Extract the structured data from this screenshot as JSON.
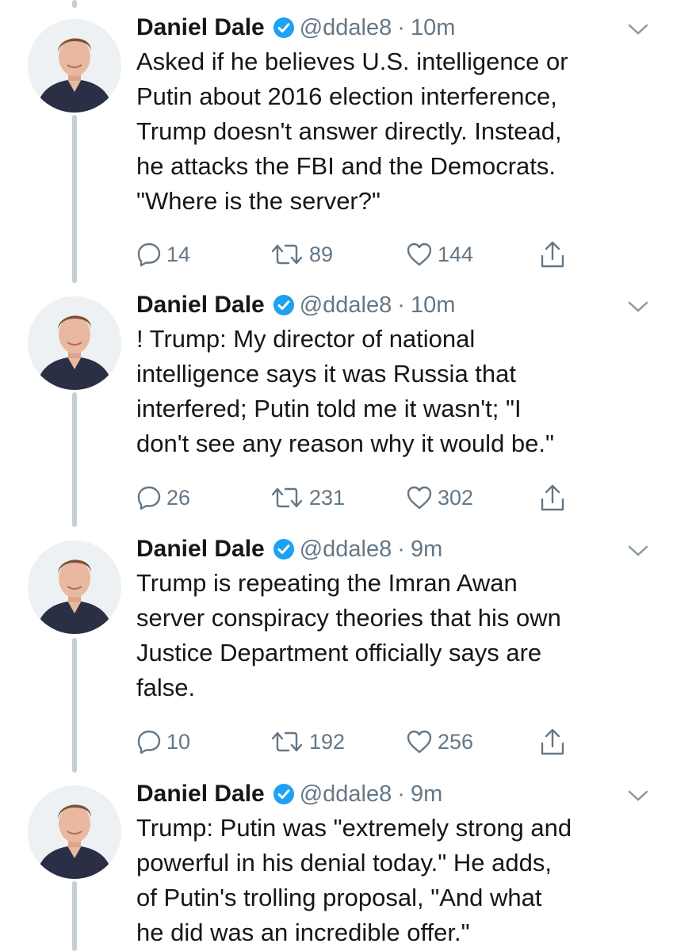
{
  "tweets": [
    {
      "name": "Daniel Dale",
      "handle": "@ddale8",
      "separator": "·",
      "time": "10m",
      "text": "Asked if he believes U.S. intelligence or\nPutin about 2016 election interference,\nTrump doesn't answer directly. Instead,\nhe attacks the FBI and the Democrats.\n\"Where is the server?\"",
      "replies": "14",
      "retweets": "89",
      "likes": "144"
    },
    {
      "name": "Daniel Dale",
      "handle": "@ddale8",
      "separator": "·",
      "time": "10m",
      "text": "! Trump: My director of national\nintelligence says it was Russia that\ninterfered; Putin told me it wasn't; \"I\ndon't see any reason why it would be.\"",
      "replies": "26",
      "retweets": "231",
      "likes": "302"
    },
    {
      "name": "Daniel Dale",
      "handle": "@ddale8",
      "separator": "·",
      "time": "9m",
      "text": "Trump is repeating the Imran Awan\nserver conspiracy theories that his own\nJustice Department officially says are\nfalse.",
      "replies": "10",
      "retweets": "192",
      "likes": "256"
    },
    {
      "name": "Daniel Dale",
      "handle": "@ddale8",
      "separator": "·",
      "time": "9m",
      "text": "Trump: Putin was \"extremely strong and\npowerful in his denial today.\" He adds,\nof Putin's trolling proposal, \"And what\nhe did was an incredible offer.\""
    }
  ],
  "colors": {
    "text": "#14171a",
    "secondary": "#657786",
    "verified": "#1da1f2",
    "thread_line": "#c4cfd6"
  },
  "icons": {
    "reply": "reply-icon",
    "retweet": "retweet-icon",
    "like": "heart-icon",
    "share": "share-icon",
    "verified": "verified-badge-icon",
    "menu": "chevron-down-icon"
  }
}
